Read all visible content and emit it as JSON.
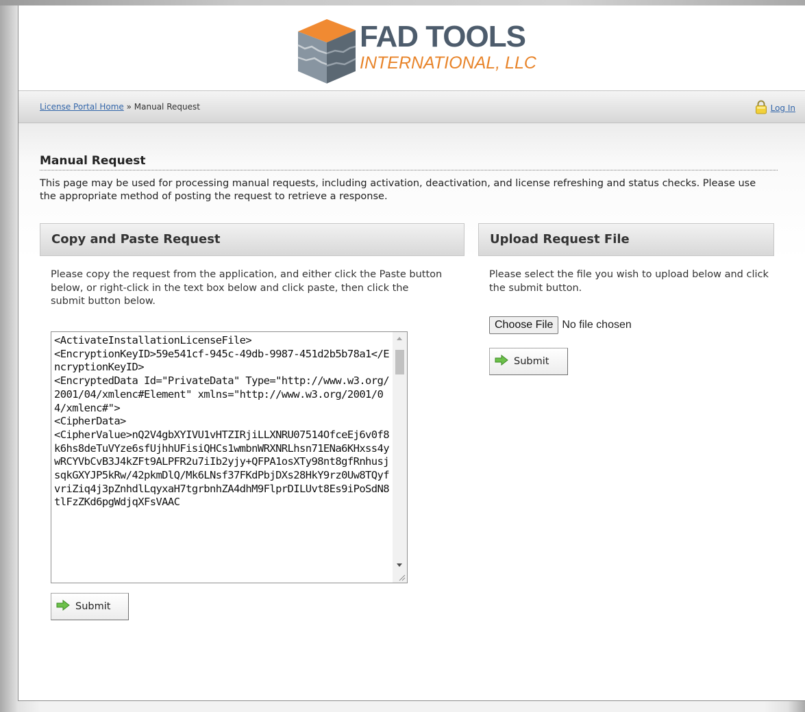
{
  "brand": {
    "title": "FAD TOOLS",
    "subtitle": "INTERNATIONAL, LLC"
  },
  "breadcrumb": {
    "home_link": "License Portal Home",
    "separator": " » ",
    "current": "Manual Request"
  },
  "login": {
    "label": "Log In"
  },
  "page": {
    "title": "Manual Request",
    "intro": "This page may be used for processing manual requests, including activation, deactivation, and license refreshing and status checks. Please use the appropriate method of posting the request to retrieve a response."
  },
  "copy_paste": {
    "heading": "Copy and Paste Request",
    "description": "Please copy the request from the application, and either click the Paste button below, or right-click in the text box below and click paste, then click the submit button below.",
    "request_text": "<ActivateInstallationLicenseFile>\n<EncryptionKeyID>59e541cf-945c-49db-9987-451d2b5b78a1</EncryptionKeyID>\n<EncryptedData Id=\"PrivateData\" Type=\"http://www.w3.org/2001/04/xmlenc#Element\" xmlns=\"http://www.w3.org/2001/04/xmlenc#\">\n<CipherData>\n<CipherValue>nQ2V4gbXYIVU1vHTZIRjiLLXNRU07514OfceEj6v0f8k6hs8deTuVYze6sfUjhhUFisiQHCs1wmbnWRXNRLhsn71ENa6KHxss4ywRCYVbCvB3J4kZFt9ALPFR2u7iIb2yjy+QFPA1osXTy98nt8gfRnhusjsqkGXYJP5kRw/42pkmDlQ/Mk6LNsf37FKdPbjDXs28HkY9rz0Uw8TQyfvriZiq4j3pZnhdlLqyxaH7tgrbnhZA4dhM9FlprDILUvt8Es9iPoSdN8tlFzZKd6pgWdjqXFsVAAC",
    "submit_label": "Submit"
  },
  "upload": {
    "heading": "Upload Request File",
    "description": "Please select the file you wish to upload below and click the submit button.",
    "choose_label": "Choose File",
    "file_status": "No file chosen",
    "submit_label": "Submit"
  },
  "colors": {
    "link": "#3366aa",
    "brand_gray": "#4d5c6c",
    "brand_orange": "#e8842a",
    "submit_arrow": "#5cb83a"
  }
}
